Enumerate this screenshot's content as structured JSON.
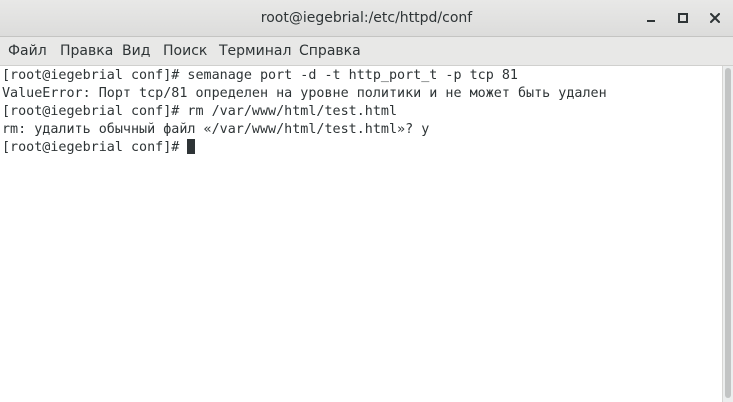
{
  "window": {
    "title": "root@iegebrial:/etc/httpd/conf"
  },
  "menu": {
    "items": [
      "Файл",
      "Правка",
      "Вид",
      "Поиск",
      "Терминал",
      "Справка"
    ]
  },
  "terminal": {
    "lines": [
      "[root@iegebrial conf]# semanage port -d -t http_port_t -p tcp 81",
      "ValueError: Порт tcp/81 определен на уровне политики и не может быть удален",
      "[root@iegebrial conf]# rm /var/www/html/test.html",
      "rm: удалить обычный файл «/var/www/html/test.html»? y",
      "[root@iegebrial conf]# "
    ]
  },
  "icons": {
    "minimize": "minimize-icon",
    "maximize": "maximize-icon",
    "close": "close-icon"
  },
  "colors": {
    "titlebar": "#dcdcdb",
    "text": "#2e3436",
    "terminal_bg": "#ffffff"
  }
}
